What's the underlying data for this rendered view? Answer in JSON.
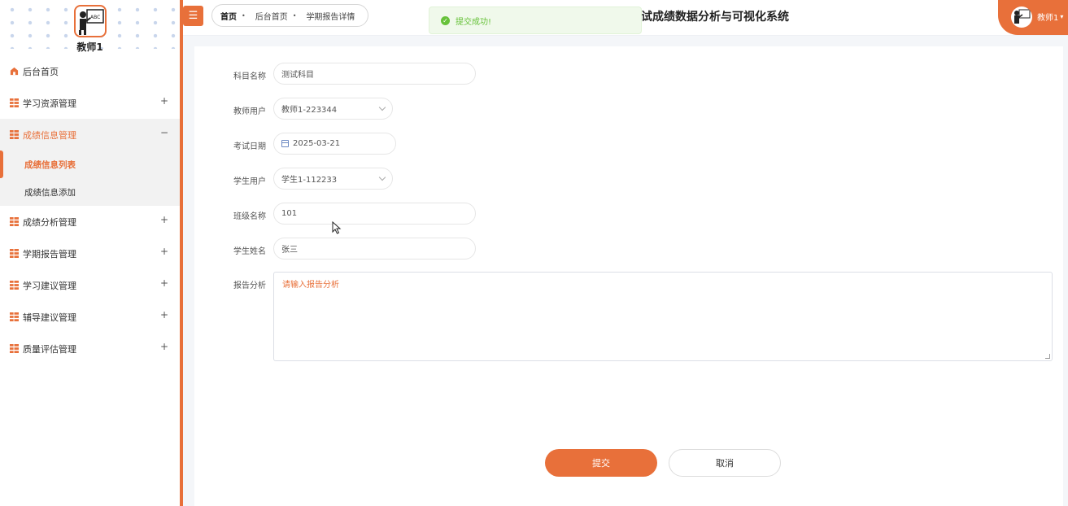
{
  "system": {
    "title": "试成绩数据分析与可视化系统"
  },
  "sidebar": {
    "username": "教师1",
    "items": [
      {
        "label": "后台首页",
        "toggle": ""
      },
      {
        "label": "学习资源管理",
        "toggle": "+"
      },
      {
        "label": "成绩信息管理",
        "toggle": "−"
      },
      {
        "label": "成绩分析管理",
        "toggle": "+"
      },
      {
        "label": "学期报告管理",
        "toggle": "+"
      },
      {
        "label": "学习建议管理",
        "toggle": "+"
      },
      {
        "label": "辅导建议管理",
        "toggle": "+"
      },
      {
        "label": "质量评估管理",
        "toggle": "+"
      }
    ],
    "subitems": [
      {
        "label": "成绩信息列表"
      },
      {
        "label": "成绩信息添加"
      }
    ]
  },
  "topbar": {
    "menu_icon": "☰",
    "breadcrumb": [
      "首页",
      "后台首页",
      "学期报告详情"
    ],
    "bc_sep": "•",
    "user": "教师1"
  },
  "toast": {
    "icon": "✓",
    "text": "提交成功!"
  },
  "form": {
    "subject": {
      "label": "科目名称",
      "value": "测试科目"
    },
    "teacher": {
      "label": "教师用户",
      "value": "教师1-223344"
    },
    "exam_date": {
      "label": "考试日期",
      "value": "2025-03-21"
    },
    "student": {
      "label": "学生用户",
      "value": "学生1-112233"
    },
    "class_name": {
      "label": "班级名称",
      "value": "101"
    },
    "student_name": {
      "label": "学生姓名",
      "value": "张三"
    },
    "analysis": {
      "label": "报告分析",
      "placeholder": "请输入报告分析"
    },
    "submit_label": "提交",
    "cancel_label": "取消"
  },
  "colors": {
    "accent": "#e8703a",
    "success": "#67c23a"
  }
}
